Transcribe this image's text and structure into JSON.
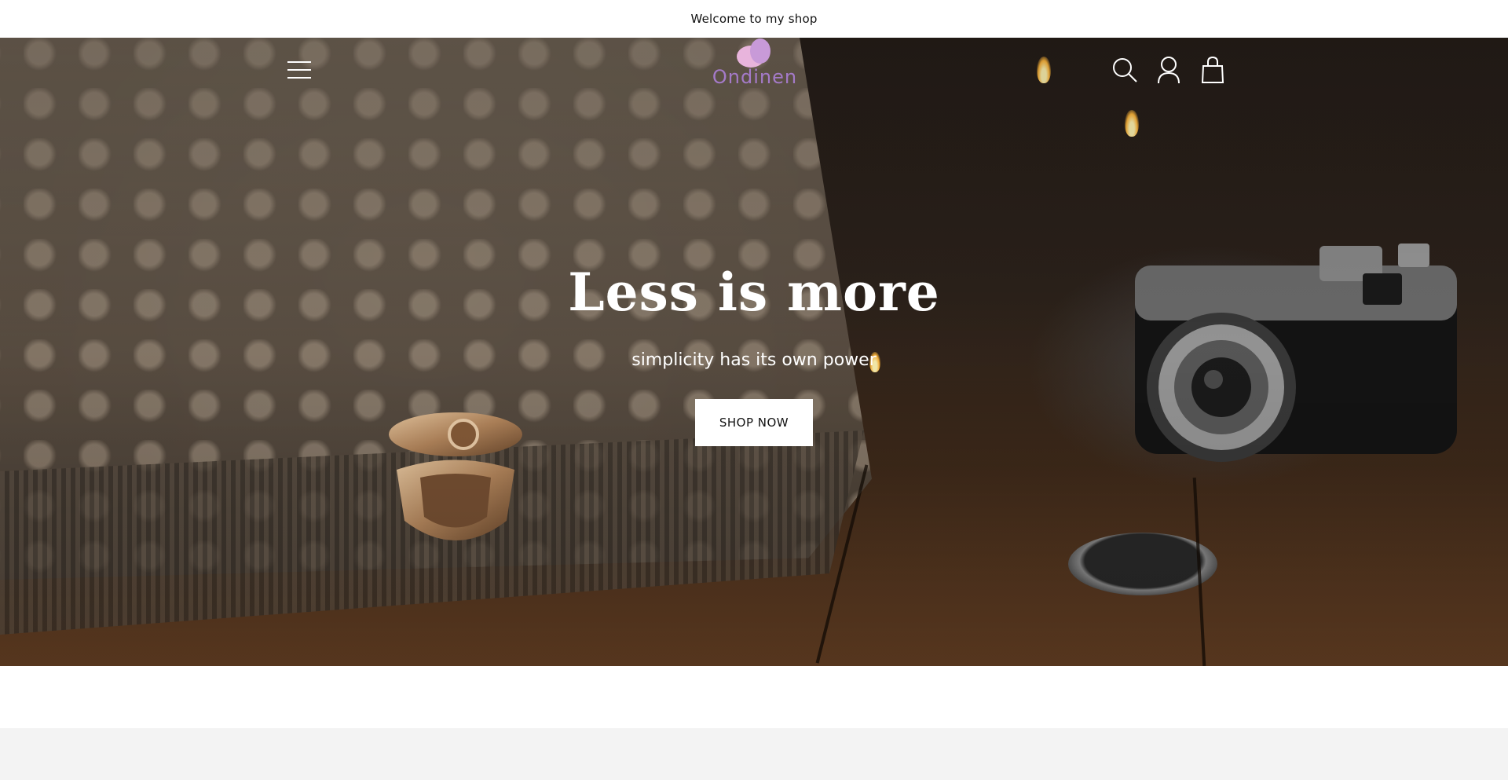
{
  "announcement": {
    "text": "Welcome to my shop"
  },
  "header": {
    "logo_text": "Ondinen",
    "icons": {
      "menu": "hamburger-menu-icon",
      "search": "search-icon",
      "account": "account-icon",
      "cart": "shopping-bag-icon"
    }
  },
  "hero": {
    "title": "Less is more",
    "subtitle": "simplicity has its own power",
    "button_label": "SHOP NOW"
  },
  "colors": {
    "logo_accent": "#a47ac8",
    "logo_mark": "#e8b4dc",
    "announcement_bg": "#ffffff",
    "next_section_bg": "#f3f3f3",
    "button_bg": "#ffffff",
    "button_text": "#121212"
  }
}
